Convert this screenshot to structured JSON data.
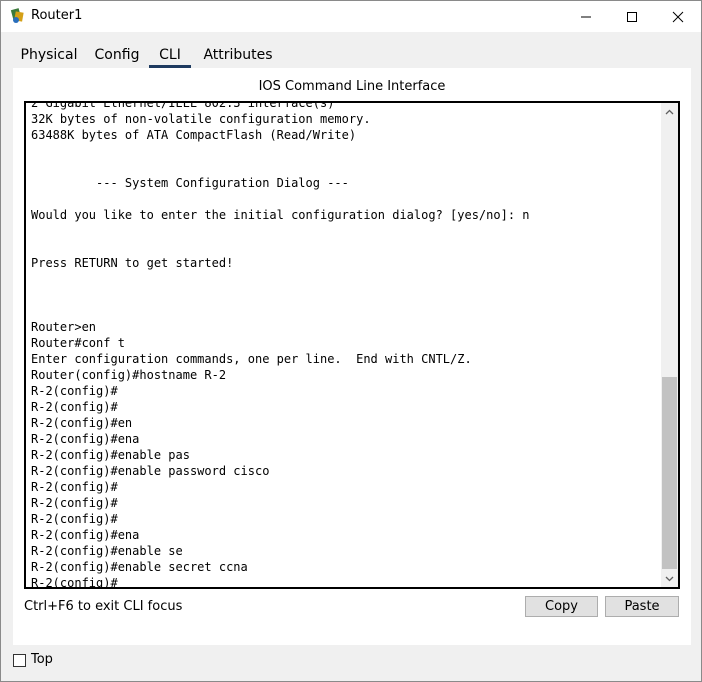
{
  "window": {
    "title": "Router1"
  },
  "tabs": [
    {
      "label": "Physical"
    },
    {
      "label": "Config"
    },
    {
      "label": "CLI"
    },
    {
      "label": "Attributes"
    }
  ],
  "active_tab": "CLI",
  "panel": {
    "title": "IOS Command Line Interface"
  },
  "cli": {
    "output": "2 Gigabit Ethernet/IEEE 802.3 interface(s)\n32K bytes of non-volatile configuration memory.\n63488K bytes of ATA CompactFlash (Read/Write)\n\n\n         --- System Configuration Dialog ---\n\nWould you like to enter the initial configuration dialog? [yes/no]: n\n\n\nPress RETURN to get started!\n\n\n\nRouter>en\nRouter#conf t\nEnter configuration commands, one per line.  End with CNTL/Z.\nRouter(config)#hostname R-2\nR-2(config)#\nR-2(config)#\nR-2(config)#en\nR-2(config)#ena\nR-2(config)#enable pas\nR-2(config)#enable password cisco\nR-2(config)#\nR-2(config)#\nR-2(config)#\nR-2(config)#ena\nR-2(config)#enable se\nR-2(config)#enable secret ccna\nR-2(config)#"
  },
  "footer": {
    "hint": "Ctrl+F6 to exit CLI focus",
    "copy_label": "Copy",
    "paste_label": "Paste"
  },
  "top_checkbox": {
    "label": "Top",
    "checked": false
  },
  "colors": {
    "active_tab_underline": "#1e3a5f",
    "scroll_thumb": "#c2c2c2"
  }
}
